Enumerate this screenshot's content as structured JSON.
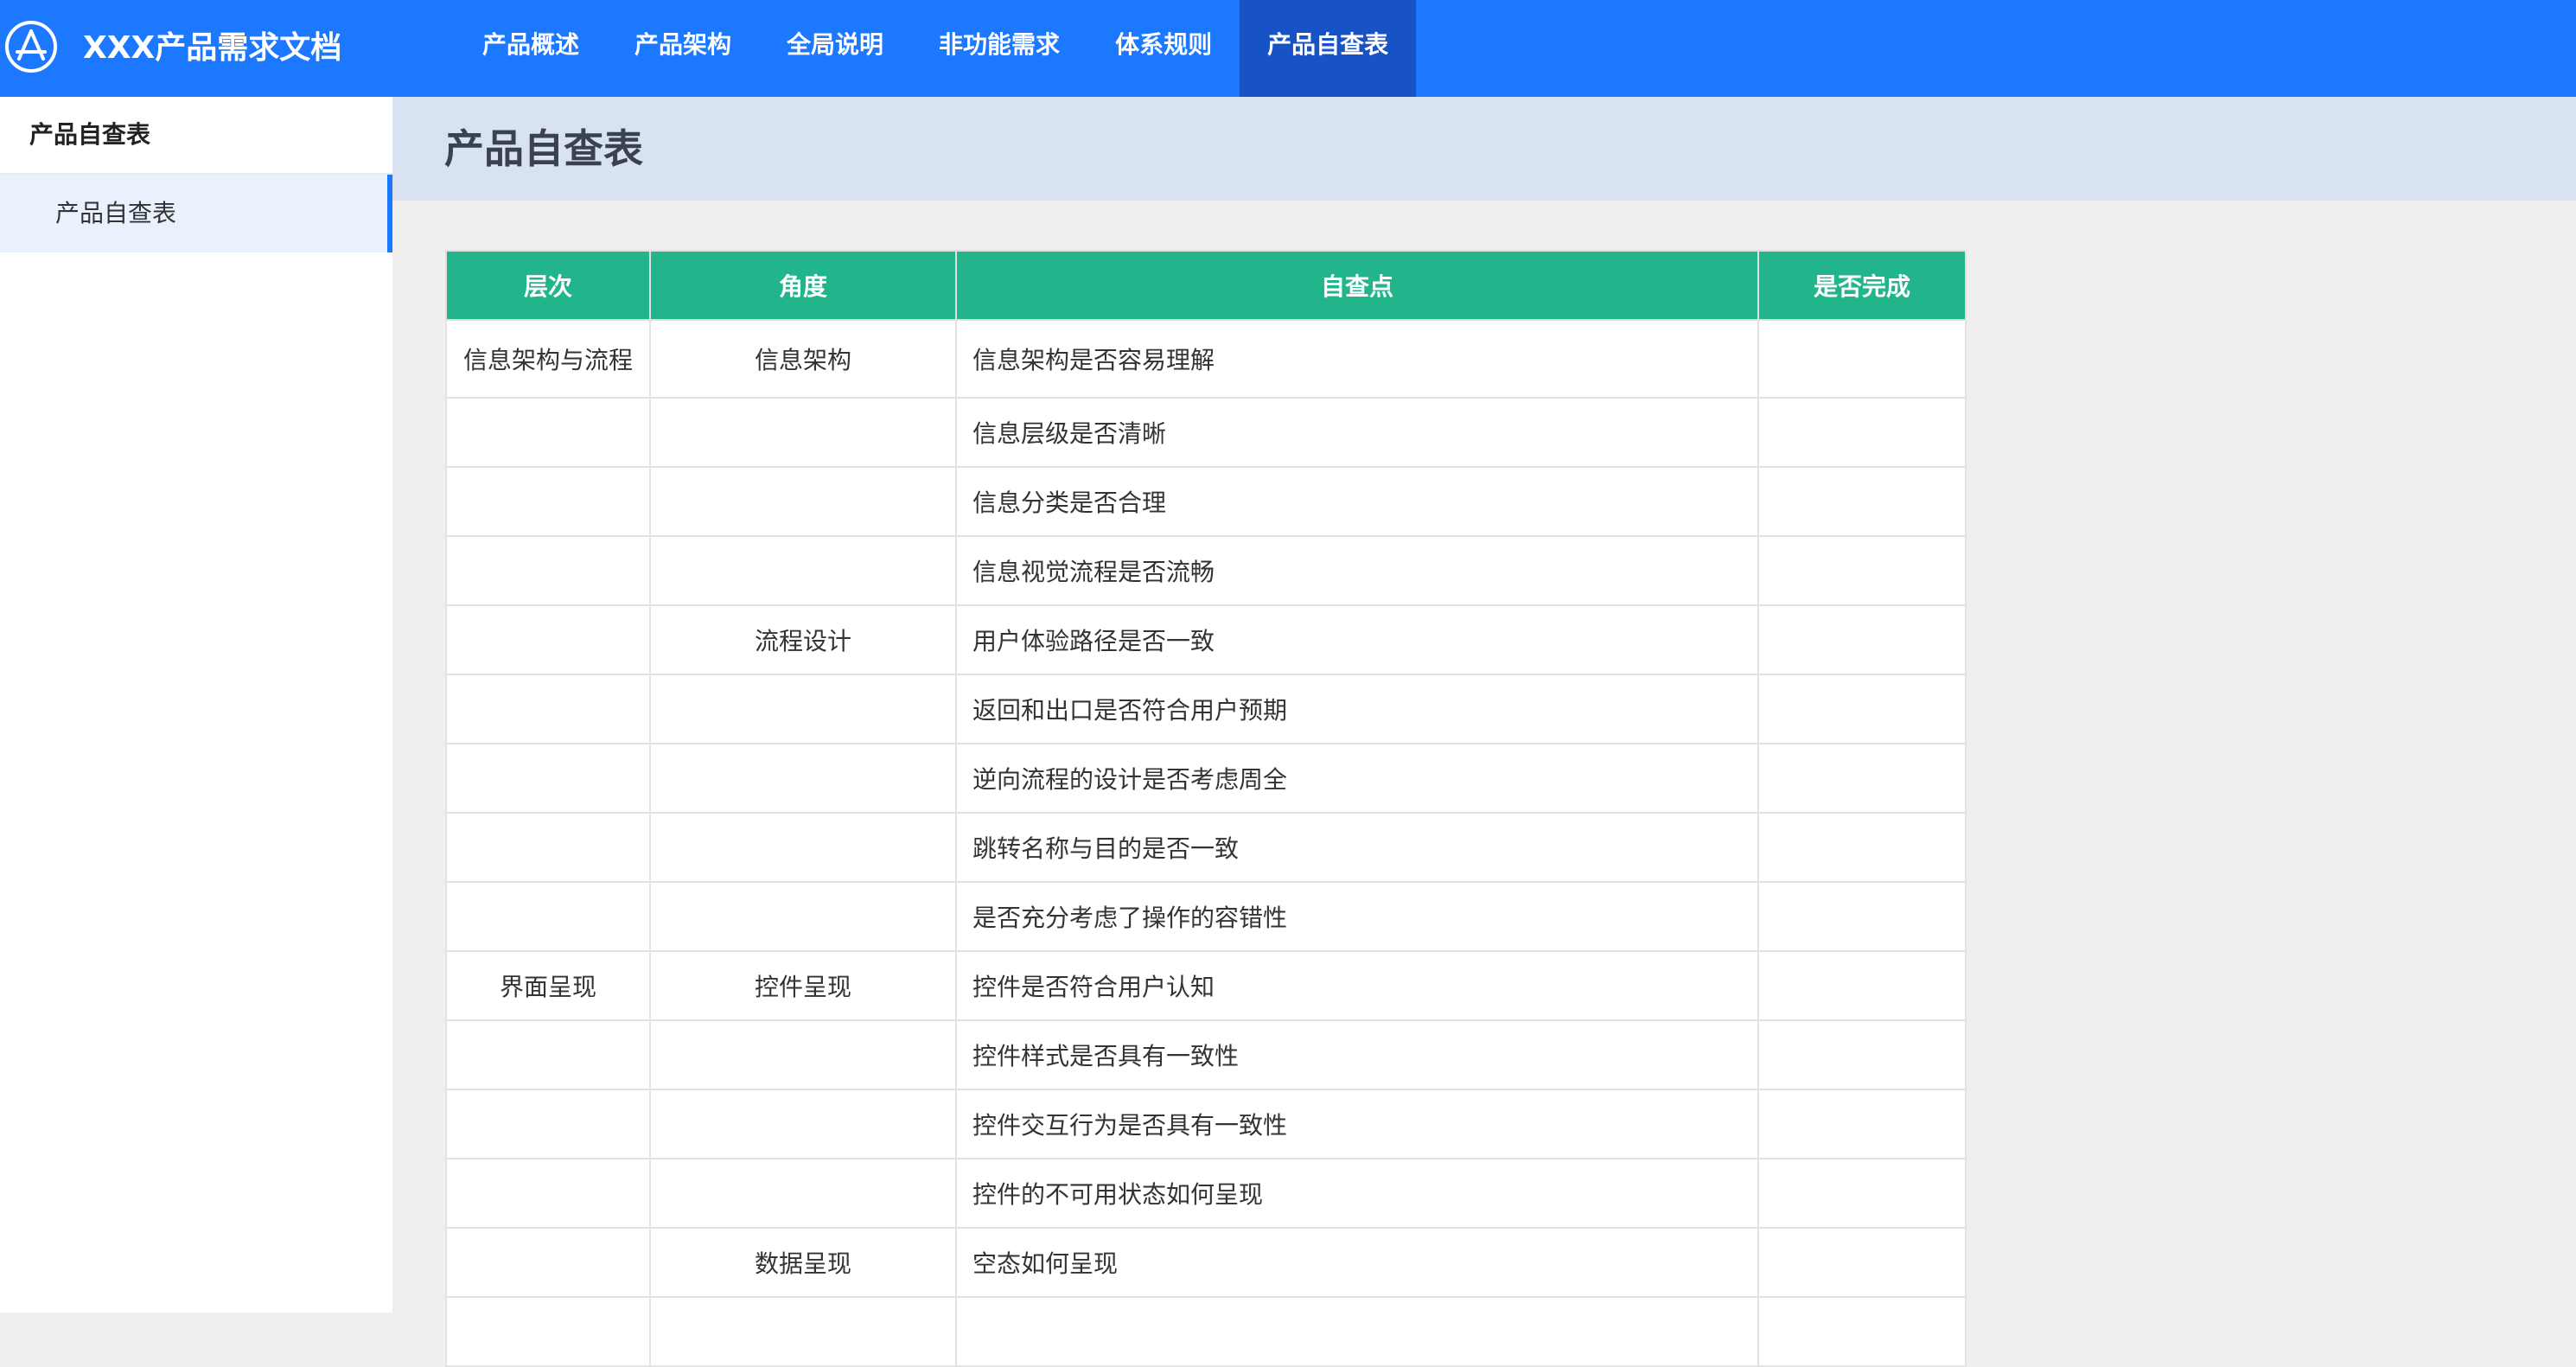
{
  "app": {
    "title": "XXX产品需求文档"
  },
  "nav": {
    "items": [
      {
        "label": "产品概述",
        "active": false
      },
      {
        "label": "产品架构",
        "active": false
      },
      {
        "label": "全局说明",
        "active": false
      },
      {
        "label": "非功能需求",
        "active": false
      },
      {
        "label": "体系规则",
        "active": false
      },
      {
        "label": "产品自查表",
        "active": true
      }
    ]
  },
  "sidebar": {
    "group_label": "产品自查表",
    "items": [
      {
        "label": "产品自查表",
        "active": true
      }
    ]
  },
  "page": {
    "title": "产品自查表"
  },
  "table": {
    "headers": [
      "层次",
      "角度",
      "自查点",
      "是否完成"
    ],
    "rows": [
      {
        "level": "信息架构与流程",
        "angle": "信息架构",
        "point": "信息架构是否容易理解",
        "done": ""
      },
      {
        "level": "",
        "angle": "",
        "point": "信息层级是否清晰",
        "done": ""
      },
      {
        "level": "",
        "angle": "",
        "point": "信息分类是否合理",
        "done": ""
      },
      {
        "level": "",
        "angle": "",
        "point": "信息视觉流程是否流畅",
        "done": ""
      },
      {
        "level": "",
        "angle": "流程设计",
        "point": "用户体验路径是否一致",
        "done": ""
      },
      {
        "level": "",
        "angle": "",
        "point": "返回和出口是否符合用户预期",
        "done": ""
      },
      {
        "level": "",
        "angle": "",
        "point": "逆向流程的设计是否考虑周全",
        "done": ""
      },
      {
        "level": "",
        "angle": "",
        "point": "跳转名称与目的是否一致",
        "done": ""
      },
      {
        "level": "",
        "angle": "",
        "point": "是否充分考虑了操作的容错性",
        "done": ""
      },
      {
        "level": "界面呈现",
        "angle": "控件呈现",
        "point": "控件是否符合用户认知",
        "done": ""
      },
      {
        "level": "",
        "angle": "",
        "point": "控件样式是否具有一致性",
        "done": ""
      },
      {
        "level": "",
        "angle": "",
        "point": "控件交互行为是否具有一致性",
        "done": ""
      },
      {
        "level": "",
        "angle": "",
        "point": "控件的不可用状态如何呈现",
        "done": ""
      },
      {
        "level": "",
        "angle": "数据呈现",
        "point": "空态如何呈现",
        "done": ""
      },
      {
        "level": "",
        "angle": "",
        "point": "",
        "done": ""
      }
    ]
  },
  "colors": {
    "topbar": "#1b78ff",
    "nav_active": "#1753c4",
    "table_header": "#22b58b",
    "page_header": "#d9e2f1",
    "sidebar_active": "#e9f1fd"
  },
  "icons": {
    "logo": "app-store-logo-icon"
  }
}
